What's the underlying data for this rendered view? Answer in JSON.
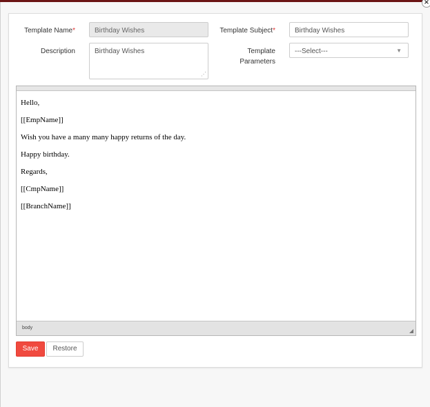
{
  "form": {
    "template_name_label": "Template Name",
    "template_name_value": "Birthday Wishes",
    "template_subject_label": "Template Subject",
    "template_subject_value": "Birthday Wishes",
    "description_label": "Description",
    "description_value": "Birthday Wishes",
    "parameters_label_line1": "Template",
    "parameters_label_line2": "Parameters",
    "parameters_selected": "---Select---",
    "required_marker": "*"
  },
  "editor": {
    "lines": [
      "Hello,",
      "[[EmpName]]",
      "Wish you have a many many happy returns of the day.",
      "Happy birthday.",
      "Regards,",
      "[[CmpName]]",
      "[[BranchName]]"
    ],
    "status_path": "body"
  },
  "buttons": {
    "save_label": "Save",
    "restore_label": "Restore"
  },
  "colors": {
    "accent": "#f04a3f",
    "topbar": "#6b1515",
    "required": "#dd3333"
  },
  "icons": {
    "close": "close-icon",
    "dropdown": "chevron-down-icon",
    "resize": "resize-grip-icon"
  }
}
